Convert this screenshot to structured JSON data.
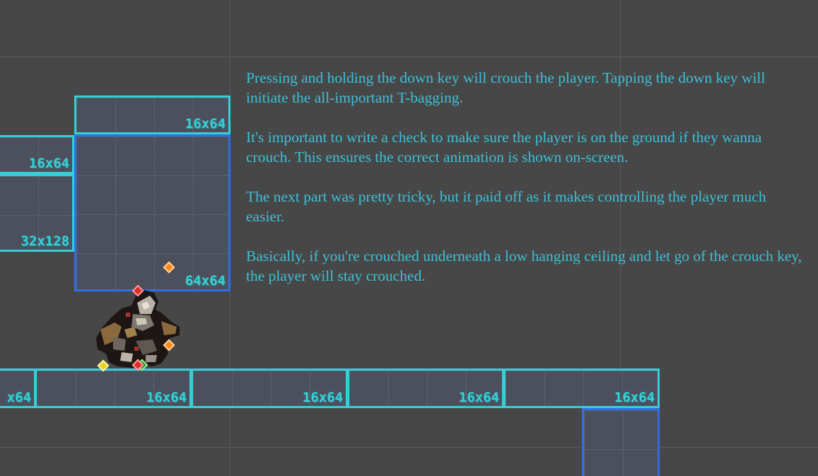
{
  "notes": {
    "paragraphs": [
      "Pressing and holding the down key will crouch the player. Tapping the down key will initiate the all-important T-bagging.",
      "It's important to write a check to make sure the player is on the ground if they wanna crouch. This ensures the correct animation is shown on-screen.",
      "The next part was pretty tricky, but it paid off as it makes controlling the player much easier.",
      "Basically, if you're crouched underneath a low hanging ceiling and let go of the crouch key, the player will stay crouched."
    ]
  },
  "tiles": {
    "top_small": "16x64",
    "left_top": "16x64",
    "left_mid": "32x128",
    "center_big": "64x64",
    "floor_0": "x64",
    "floor_1": "16x64",
    "floor_2": "16x64",
    "floor_3": "16x64",
    "floor_4": "16x64"
  },
  "colors": {
    "background": "#474747",
    "text": "#3dbfd6",
    "tile_border_teal": "#35cfd8",
    "tile_border_blue": "#2f6fe6",
    "gizmo_orange": "#f08a1c",
    "gizmo_red": "#d9302a",
    "gizmo_yellow": "#e8d21a",
    "gizmo_green": "#2e9d2e"
  },
  "icons": {
    "player": "player-sprite",
    "gizmos": [
      "orange-gizmo-icon",
      "red-gizmo-icon",
      "yellow-gizmo-icon",
      "green-gizmo-icon"
    ]
  }
}
